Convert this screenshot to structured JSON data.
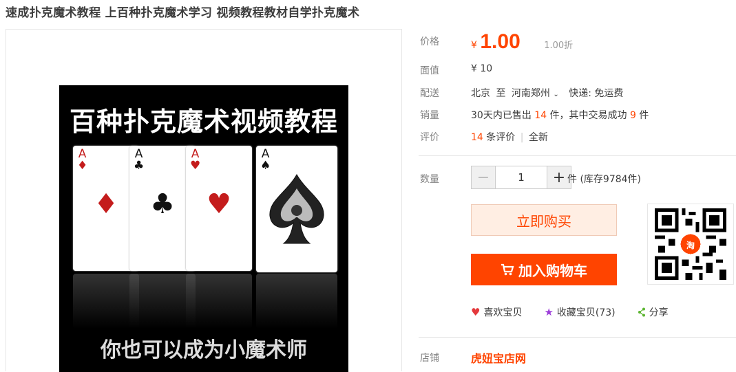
{
  "product": {
    "title": "速成扑克魔术教程 上百种扑克魔术学习 视频教程教材自学扑克魔术",
    "image": {
      "heading": "百种扑克魔术视频教程",
      "footer": "你也可以成为小魔术师",
      "cards": [
        {
          "rank": "A",
          "suit": "♦",
          "color": "red"
        },
        {
          "rank": "A",
          "suit": "♣",
          "color": "black"
        },
        {
          "rank": "A",
          "suit": "♥",
          "color": "red"
        },
        {
          "rank": "A",
          "suit": "♠",
          "color": "black"
        }
      ]
    }
  },
  "info": {
    "price_label": "价格",
    "currency": "¥",
    "price": "1.00",
    "discount": "1.00折",
    "face_label": "面值",
    "face_value": "¥ 10",
    "delivery_label": "配送",
    "delivery_from": "北京",
    "delivery_to_word": "至",
    "delivery_to": "河南郑州",
    "express": "快递: 免运费",
    "sales_label": "销量",
    "sales_prefix": "30天内已售出",
    "sales_count": "14",
    "sales_mid": "件，其中交易成功",
    "sales_success": "9",
    "sales_suffix": "件",
    "review_label": "评价",
    "review_count": "14",
    "review_suffix": "条评价",
    "review_sep": "|",
    "review_condition": "全新",
    "qty_label": "数量",
    "qty_value": "1",
    "qty_unit": "件 (库存9784件)",
    "buy_label": "立即购买",
    "cart_label": "加入购物车",
    "qr_badge": "淘",
    "like_label": "喜欢宝贝",
    "fav_label": "收藏宝贝(73)",
    "share_label": "分享",
    "partial_label": "店铺",
    "partial_shop": "虎妞宝店网"
  },
  "colors": {
    "accent": "#ff4400",
    "heart": "#e4393c",
    "star": "#9c3dd9",
    "share": "#5cb531"
  }
}
